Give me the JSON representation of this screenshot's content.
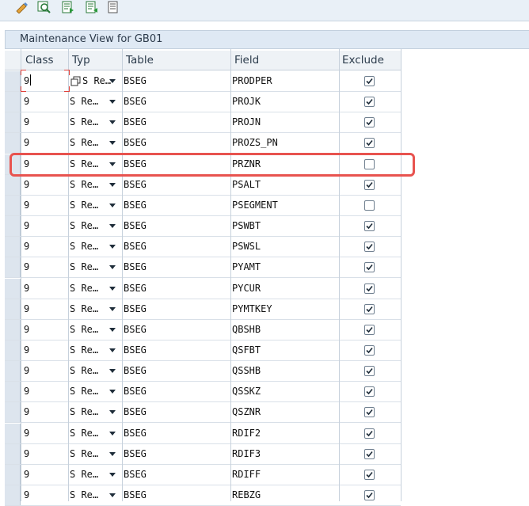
{
  "toolbar": {
    "icons": [
      "edit-icon",
      "find-icon",
      "export-icon",
      "import-icon",
      "document-icon"
    ]
  },
  "panel": {
    "title": "Maintenance View for GB01"
  },
  "table": {
    "headers": {
      "class": "Class",
      "typ": "Typ",
      "table": "Table",
      "field": "Field",
      "exclude": "Exclude"
    },
    "rows": [
      {
        "class": "9",
        "typ": "S Re…",
        "table": "BSEG",
        "field": "PRODPER",
        "exclude": true
      },
      {
        "class": "9",
        "typ": "S Re…",
        "table": "BSEG",
        "field": "PROJK",
        "exclude": true
      },
      {
        "class": "9",
        "typ": "S Re…",
        "table": "BSEG",
        "field": "PROJN",
        "exclude": true
      },
      {
        "class": "9",
        "typ": "S Re…",
        "table": "BSEG",
        "field": "PROZS_PN",
        "exclude": true
      },
      {
        "class": "9",
        "typ": "S Re…",
        "table": "BSEG",
        "field": "PRZNR",
        "exclude": false
      },
      {
        "class": "9",
        "typ": "S Re…",
        "table": "BSEG",
        "field": "PSALT",
        "exclude": true
      },
      {
        "class": "9",
        "typ": "S Re…",
        "table": "BSEG",
        "field": "PSEGMENT",
        "exclude": false
      },
      {
        "class": "9",
        "typ": "S Re…",
        "table": "BSEG",
        "field": "PSWBT",
        "exclude": true
      },
      {
        "class": "9",
        "typ": "S Re…",
        "table": "BSEG",
        "field": "PSWSL",
        "exclude": true
      },
      {
        "class": "9",
        "typ": "S Re…",
        "table": "BSEG",
        "field": "PYAMT",
        "exclude": true
      },
      {
        "class": "9",
        "typ": "S Re…",
        "table": "BSEG",
        "field": "PYCUR",
        "exclude": true
      },
      {
        "class": "9",
        "typ": "S Re…",
        "table": "BSEG",
        "field": "PYMTKEY",
        "exclude": true
      },
      {
        "class": "9",
        "typ": "S Re…",
        "table": "BSEG",
        "field": "QBSHB",
        "exclude": true
      },
      {
        "class": "9",
        "typ": "S Re…",
        "table": "BSEG",
        "field": "QSFBT",
        "exclude": true
      },
      {
        "class": "9",
        "typ": "S Re…",
        "table": "BSEG",
        "field": "QSSHB",
        "exclude": true
      },
      {
        "class": "9",
        "typ": "S Re…",
        "table": "BSEG",
        "field": "QSSKZ",
        "exclude": true
      },
      {
        "class": "9",
        "typ": "S Re…",
        "table": "BSEG",
        "field": "QSZNR",
        "exclude": true
      },
      {
        "class": "9",
        "typ": "S Re…",
        "table": "BSEG",
        "field": "RDIF2",
        "exclude": true
      },
      {
        "class": "9",
        "typ": "S Re…",
        "table": "BSEG",
        "field": "RDIF3",
        "exclude": true
      },
      {
        "class": "9",
        "typ": "S Re…",
        "table": "BSEG",
        "field": "RDIFF",
        "exclude": true
      },
      {
        "class": "9",
        "typ": "S Re…",
        "table": "BSEG",
        "field": "REBZG",
        "exclude": true
      }
    ]
  },
  "colors": {
    "highlight": "#e8534f",
    "header_bg": "#eef2f6",
    "toolbar_bg": "#e9f0f7"
  }
}
